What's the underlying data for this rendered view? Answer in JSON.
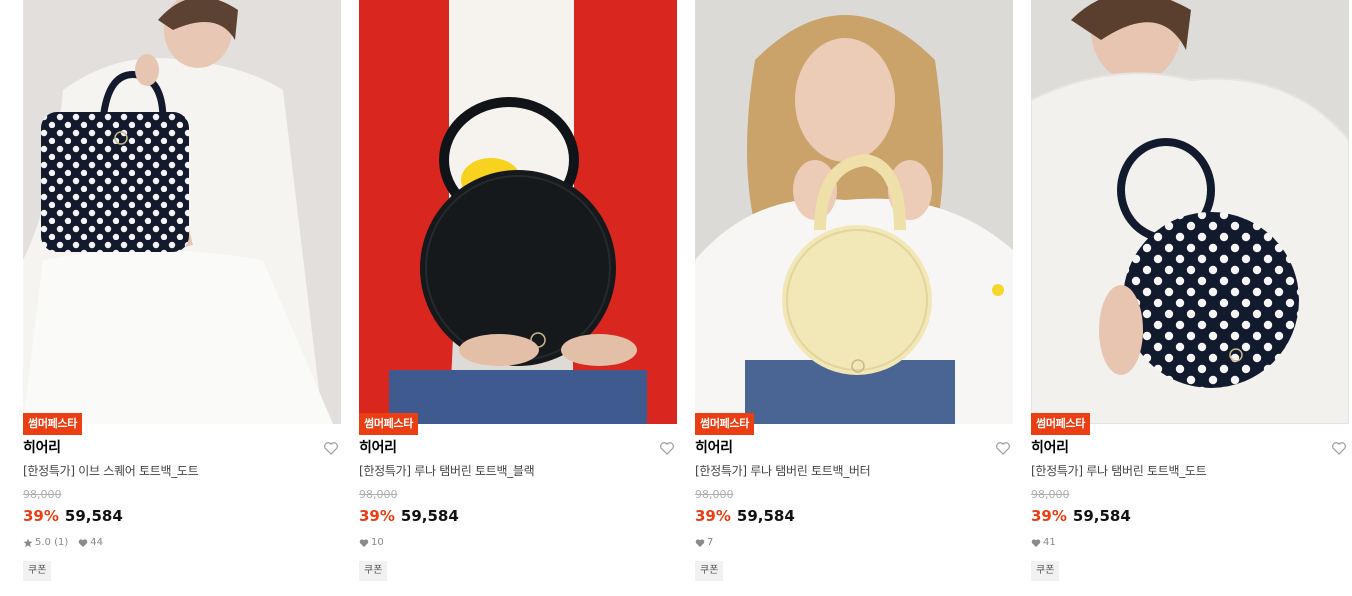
{
  "products": [
    {
      "event_badge": "썸머페스타",
      "brand": "히어리",
      "title": "[한정특가] 이브 스퀘어 토트백_도트",
      "original_price": "98,000",
      "discount": "39%",
      "price": "59,584",
      "rating": "5.0",
      "review_count": "(1)",
      "likes": "44",
      "coupon": "쿠폰",
      "image": "model holding navy polka-dot square tote bag"
    },
    {
      "event_badge": "썸머페스타",
      "brand": "히어리",
      "title": "[한정특가] 루나 탬버린 토트백_블랙",
      "original_price": "98,000",
      "discount": "39%",
      "price": "59,584",
      "rating": "",
      "review_count": "",
      "likes": "10",
      "coupon": "쿠폰",
      "image": "model holding black round tote bag"
    },
    {
      "event_badge": "썸머페스타",
      "brand": "히어리",
      "title": "[한정특가] 루나 탬버린 토트백_버터",
      "original_price": "98,000",
      "discount": "39%",
      "price": "59,584",
      "rating": "",
      "review_count": "",
      "likes": "7",
      "coupon": "쿠폰",
      "image": "model holding butter-yellow round tote bag"
    },
    {
      "event_badge": "썸머페스타",
      "brand": "히어리",
      "title": "[한정특가] 루나 탬버린 토트백_도트",
      "original_price": "98,000",
      "discount": "39%",
      "price": "59,584",
      "rating": "",
      "review_count": "",
      "likes": "41",
      "coupon": "쿠폰",
      "image": "model holding navy polka-dot round tote bag"
    }
  ],
  "colors": {
    "accent": "#ec3e13",
    "text": "#111111",
    "muted": "#8a8a8a",
    "strike": "#b0b0b0"
  },
  "icons": {
    "wishlist": "heart-outline-icon",
    "rating": "star-icon",
    "likes": "heart-filled-icon"
  }
}
